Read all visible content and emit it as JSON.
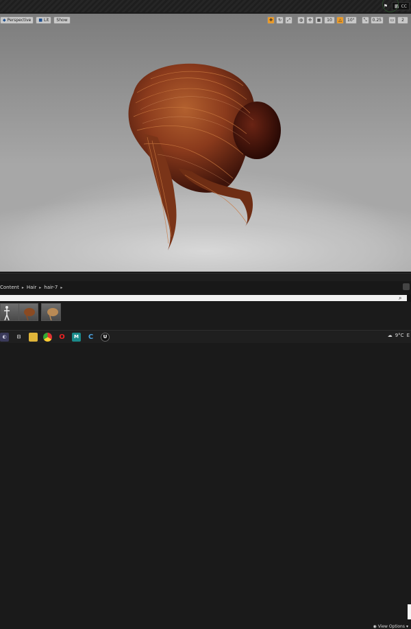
{
  "topbar": {
    "account_label": "CC"
  },
  "viewport": {
    "perspective_label": "Perspective",
    "lit_label": "Lit",
    "show_label": "Show",
    "grid_snap_value": "10",
    "rotation_snap_value": "10°",
    "scale_snap_value": "0.25",
    "camera_speed_value": "2",
    "active_color": "#e89a2b"
  },
  "content_browser": {
    "breadcrumbs": [
      "Content",
      "Hair",
      "hair-7"
    ],
    "search_placeholder": "",
    "view_options_label": "View Options"
  },
  "taskbar": {
    "weather_temp": "9°C",
    "tray_text": "E"
  }
}
